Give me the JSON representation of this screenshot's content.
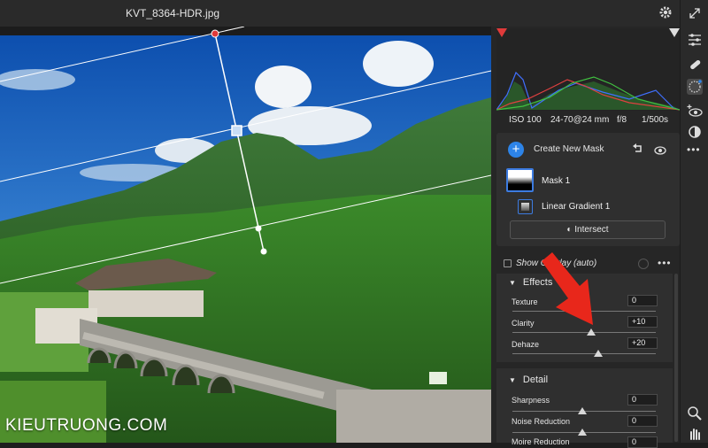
{
  "window": {
    "file_title": "KVT_8364-HDR.jpg"
  },
  "exif": {
    "iso": "ISO 100",
    "lens": "24-70@24 mm",
    "aperture": "f/8",
    "shutter": "1/500s"
  },
  "masks": {
    "create_label": "Create New Mask",
    "add_symbol": "+",
    "mask1_name": "Mask 1",
    "component_name": "Linear Gradient 1",
    "intersect_label": "Intersect"
  },
  "overlay": {
    "label": "Show Overlay (auto)",
    "checked": false,
    "more": "•••"
  },
  "effects": {
    "title": "Effects",
    "sliders": [
      {
        "label": "Texture",
        "value": "0",
        "level": 0
      },
      {
        "label": "Clarity",
        "value": "+10",
        "level": 10
      },
      {
        "label": "Dehaze",
        "value": "+20",
        "level": 20
      }
    ]
  },
  "detail": {
    "title": "Detail",
    "sliders": [
      {
        "label": "Sharpness",
        "value": "0",
        "level": 0
      },
      {
        "label": "Noise Reduction",
        "value": "0",
        "level": 0
      },
      {
        "label": "Moire Reduction",
        "value": "0",
        "level": 0
      }
    ]
  },
  "watermark": "KIEUTRUONG.COM",
  "icons": [
    "gear-icon",
    "collapse-icon",
    "adjust-sliders-icon",
    "healing-brush-icon",
    "masking-icon",
    "red-eye-icon",
    "presets-icon",
    "more-tools-icon",
    "zoom-icon",
    "hand-icon",
    "undo-icon",
    "eye-icon",
    "intersect-icon"
  ],
  "colors": {
    "accent": "#2d84e8",
    "mask_outline": "#3c7be0",
    "annotation_arrow": "#e8271b",
    "histogram_red": "#e04040",
    "histogram_green": "#40c040",
    "histogram_blue": "#4070ff"
  }
}
